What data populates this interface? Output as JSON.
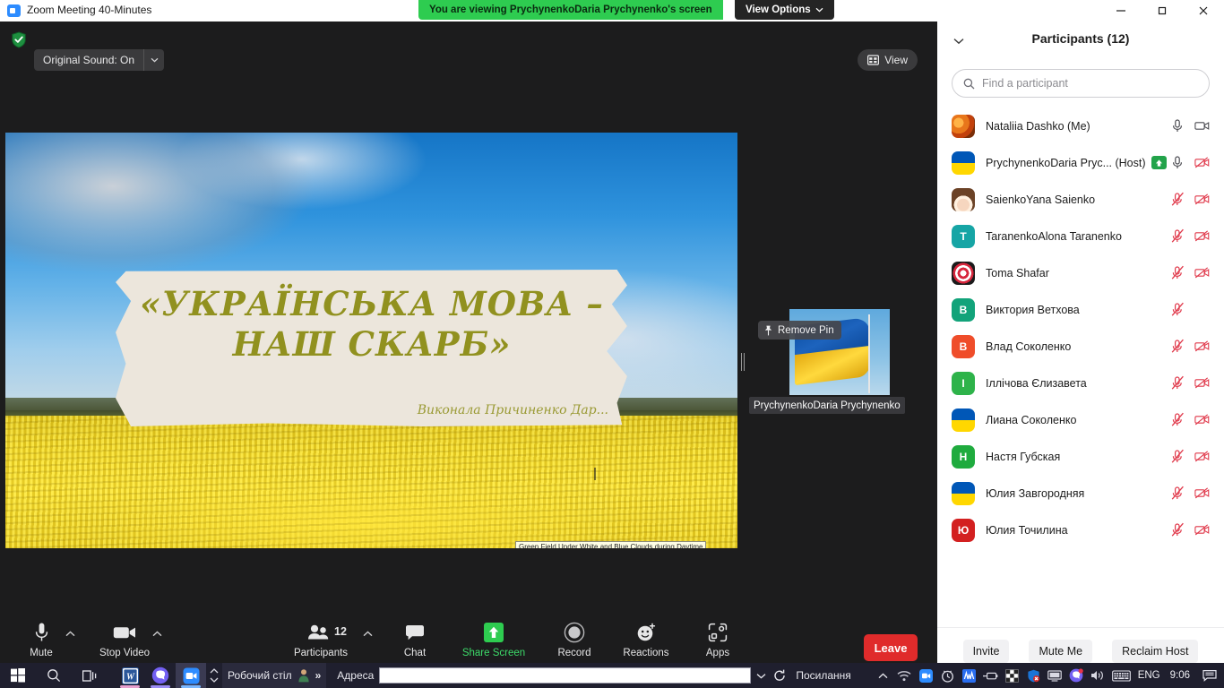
{
  "window": {
    "title": "Zoom Meeting 40-Minutes",
    "logo_icon": "zoom-logo-icon",
    "minimize_icon": "minimize-icon",
    "maximize_icon": "maximize-icon",
    "close_icon": "close-icon"
  },
  "view_banner": {
    "text": "You are viewing PrychynenkoDaria Prychynenko's screen",
    "options_label": "View Options",
    "options_caret_icon": "chevron-down-icon",
    "bg_color": "#2ecc50"
  },
  "stage_top": {
    "shield_icon": "security-shield-icon",
    "original_sound_label": "Original Sound: On",
    "original_sound_caret_icon": "chevron-down-icon",
    "view_button_label": "View",
    "view_button_icon": "layout-grid-icon"
  },
  "shared_screen": {
    "slide_title_line1": "«УКРАЇНСЬКА МОВА –",
    "slide_title_line2": "НАШ СКАРБ»",
    "slide_subtitle": "Виконала Причиненко Дар...",
    "image_tooltip": "Green Field Under White and Blue Clouds during Daytime",
    "title_color": "#91911f",
    "paper_color": "#ece6dc"
  },
  "pinned_thumbnail": {
    "pin_button_label": "Remove Pin",
    "pin_icon": "pin-icon",
    "name": "PrychynenkoDaria Prychynenko"
  },
  "toolbar": {
    "items": [
      {
        "label": "Mute",
        "icon": "microphone-icon",
        "has_caret": true,
        "green": false
      },
      {
        "label": "Stop Video",
        "icon": "video-camera-icon",
        "has_caret": true,
        "green": false
      },
      {
        "label": "Participants",
        "icon": "participants-icon",
        "has_caret": true,
        "green": false,
        "count": "12"
      },
      {
        "label": "Chat",
        "icon": "chat-bubble-icon",
        "has_caret": false,
        "green": false
      },
      {
        "label": "Share Screen",
        "icon": "share-screen-icon",
        "has_caret": false,
        "green": true
      },
      {
        "label": "Record",
        "icon": "record-icon",
        "has_caret": false,
        "green": false
      },
      {
        "label": "Reactions",
        "icon": "reactions-smiley-icon",
        "has_caret": false,
        "green": false
      },
      {
        "label": "Apps",
        "icon": "apps-icon",
        "has_caret": false,
        "green": false
      }
    ],
    "leave_label": "Leave",
    "leave_color": "#e02b2b"
  },
  "participants_panel": {
    "collapse_icon": "chevron-down-icon",
    "title": "Participants (12)",
    "search": {
      "placeholder": "Find a participant",
      "value": "",
      "icon": "search-icon"
    },
    "rows": [
      {
        "name": "Nataliia Dashko (Me)",
        "avatar_kind": "photo-autumn",
        "avatar_text": "",
        "host": false,
        "mic": "unmuted",
        "cam": "on"
      },
      {
        "name": "PrychynenkoDaria Pryc... (Host)",
        "avatar_kind": "flag",
        "avatar_text": "",
        "host": true,
        "mic": "unmuted",
        "cam": "off"
      },
      {
        "name": "SaienkoYana Saienko",
        "avatar_kind": "photo-girl",
        "avatar_text": "",
        "host": false,
        "mic": "muted",
        "cam": "off"
      },
      {
        "name": "TaranenkoAlona Taranenko",
        "avatar_kind": "letter",
        "avatar_text": "T",
        "avatar_color": "#16a5a5",
        "host": false,
        "mic": "muted",
        "cam": "off"
      },
      {
        "name": "Toma Shafar",
        "avatar_kind": "photo-embroidery",
        "avatar_text": "",
        "host": false,
        "mic": "muted",
        "cam": "off"
      },
      {
        "name": "Виктория Ветхова",
        "avatar_kind": "letter",
        "avatar_text": "В",
        "avatar_color": "#12a37a",
        "host": false,
        "mic": "muted",
        "cam": "none"
      },
      {
        "name": "Влад Соколенко",
        "avatar_kind": "letter",
        "avatar_text": "В",
        "avatar_color": "#ef4d2a",
        "host": false,
        "mic": "muted",
        "cam": "off"
      },
      {
        "name": "Іллічова Єлизавета",
        "avatar_kind": "letter",
        "avatar_text": "І",
        "avatar_color": "#2eb34a",
        "host": false,
        "mic": "muted",
        "cam": "off"
      },
      {
        "name": "Лиана Соколенко",
        "avatar_kind": "flag",
        "avatar_text": "",
        "host": false,
        "mic": "muted",
        "cam": "off"
      },
      {
        "name": "Настя Губская",
        "avatar_kind": "letter",
        "avatar_text": "Н",
        "avatar_color": "#1fab3e",
        "host": false,
        "mic": "muted",
        "cam": "off"
      },
      {
        "name": "Юлия Завгородняя",
        "avatar_kind": "flag",
        "avatar_text": "",
        "host": false,
        "mic": "muted",
        "cam": "off"
      },
      {
        "name": "Юлия Точилина",
        "avatar_kind": "letter",
        "avatar_text": "Ю",
        "avatar_color": "#d32020",
        "host": false,
        "mic": "muted",
        "cam": "off"
      }
    ],
    "footer": {
      "invite_label": "Invite",
      "mute_me_label": "Mute Me",
      "reclaim_host_label": "Reclaim Host"
    }
  },
  "taskbar": {
    "start_icon": "windows-start-icon",
    "search_icon": "search-icon",
    "taskview_icon": "task-view-icon",
    "apps": [
      {
        "name": "word-icon",
        "color": "#2b579a",
        "glyph": "W",
        "indicator": "#f0a",
        "active": true
      },
      {
        "name": "viber-icon",
        "color": "#7360f2",
        "glyph": "",
        "indicator": "#7360f2",
        "active": true
      },
      {
        "name": "zoom-icon",
        "color": "#2d8cff",
        "glyph": "",
        "indicator": "#2d8cff",
        "active": true
      }
    ],
    "desktop_label": "Робочий стіл",
    "chevrons_icon": "double-chevron-right-icon",
    "address_label": "Адреса",
    "address_value": "",
    "links_label": "Посилання",
    "tray_icons": [
      "wifi-icon",
      "zoom-tray-icon",
      "clock-tray-icon",
      "winamp-tray-icon",
      "usb-battery-icon",
      "checker-tray-icon",
      "shield-error-icon",
      "monitor-tray-icon",
      "viber-tray-icon",
      "volume-icon",
      "keyboard-icon"
    ],
    "language": "ENG",
    "clock": "9:06",
    "notification_icon": "notification-icon"
  }
}
